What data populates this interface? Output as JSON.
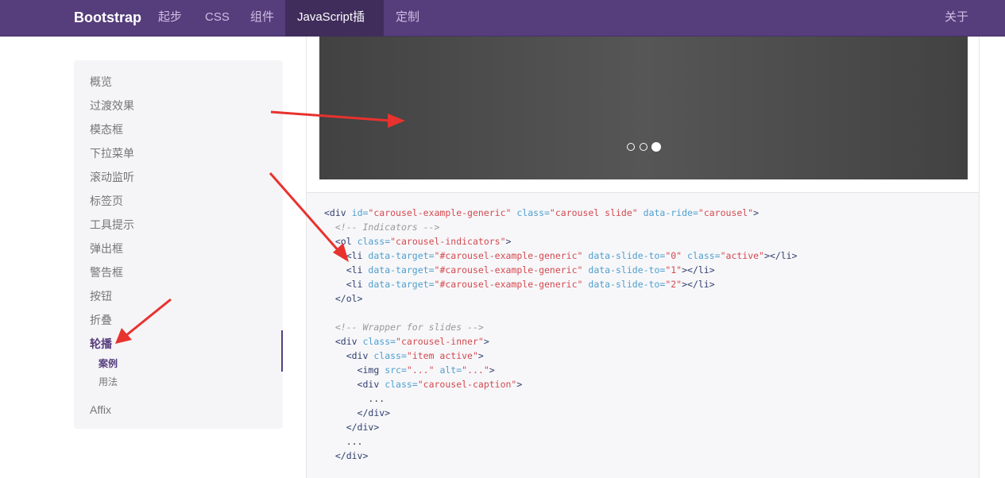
{
  "navbar": {
    "brand": "Bootstrap",
    "items": [
      "起步",
      "CSS",
      "组件",
      "JavaScript插件",
      "定制"
    ],
    "right_item": "关于",
    "active_index": 3
  },
  "sidebar": {
    "items": [
      "概览",
      "过渡效果",
      "模态框",
      "下拉菜单",
      "滚动监听",
      "标签页",
      "工具提示",
      "弹出框",
      "警告框",
      "按钮",
      "折叠",
      "轮播"
    ],
    "active_item": "轮播",
    "sub_items": [
      "案例",
      "用法"
    ],
    "active_sub": "案例",
    "last_item": "Affix"
  },
  "carousel": {
    "indicator_count": 3,
    "active_indicator": 2
  },
  "code": {
    "lines": [
      "<div id=\"carousel-example-generic\" class=\"carousel slide\" data-ride=\"carousel\">",
      "  <!-- Indicators -->",
      "  <ol class=\"carousel-indicators\">",
      "    <li data-target=\"#carousel-example-generic\" data-slide-to=\"0\" class=\"active\"></li>",
      "    <li data-target=\"#carousel-example-generic\" data-slide-to=\"1\"></li>",
      "    <li data-target=\"#carousel-example-generic\" data-slide-to=\"2\"></li>",
      "  </ol>",
      "",
      "  <!-- Wrapper for slides -->",
      "  <div class=\"carousel-inner\">",
      "    <div class=\"item active\">",
      "      <img src=\"...\" alt=\"...\">",
      "      <div class=\"carousel-caption\">",
      "        ...",
      "      </div>",
      "    </div>",
      "    ...",
      "  </div>"
    ]
  },
  "colors": {
    "navbar_bg": "#563d7c",
    "navbar_active": "#402d5c",
    "annotation_arrow": "#e8322e"
  }
}
